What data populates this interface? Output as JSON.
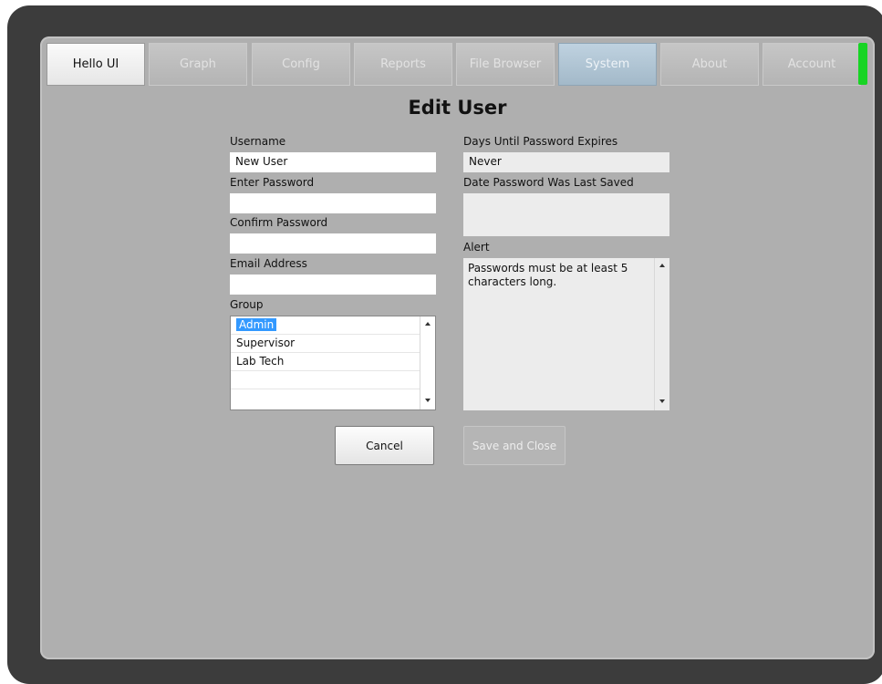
{
  "tabs": [
    {
      "label": "Hello UI"
    },
    {
      "label": "Graph"
    },
    {
      "label": "Config"
    },
    {
      "label": "Reports"
    },
    {
      "label": "File Browser"
    },
    {
      "label": "System"
    },
    {
      "label": "About"
    },
    {
      "label": "Account"
    }
  ],
  "colors": {
    "status_indicator": "#17d424",
    "selection": "#3399ff"
  },
  "form": {
    "title": "Edit User",
    "username": {
      "label": "Username",
      "value": "New User"
    },
    "password": {
      "label": "Enter Password",
      "value": ""
    },
    "confirm_password": {
      "label": "Confirm Password",
      "value": ""
    },
    "email": {
      "label": "Email Address",
      "value": ""
    },
    "group": {
      "label": "Group",
      "options": [
        "Admin",
        "Supervisor",
        "Lab Tech"
      ],
      "selected": "Admin"
    },
    "days_until_expire": {
      "label": "Days Until Password Expires",
      "value": "Never"
    },
    "date_last_saved": {
      "label": "Date Password Was Last Saved",
      "value": ""
    },
    "alert": {
      "label": "Alert",
      "text": "Passwords must be at least 5 characters long."
    },
    "cancel_label": "Cancel",
    "save_label": "Save and Close"
  }
}
